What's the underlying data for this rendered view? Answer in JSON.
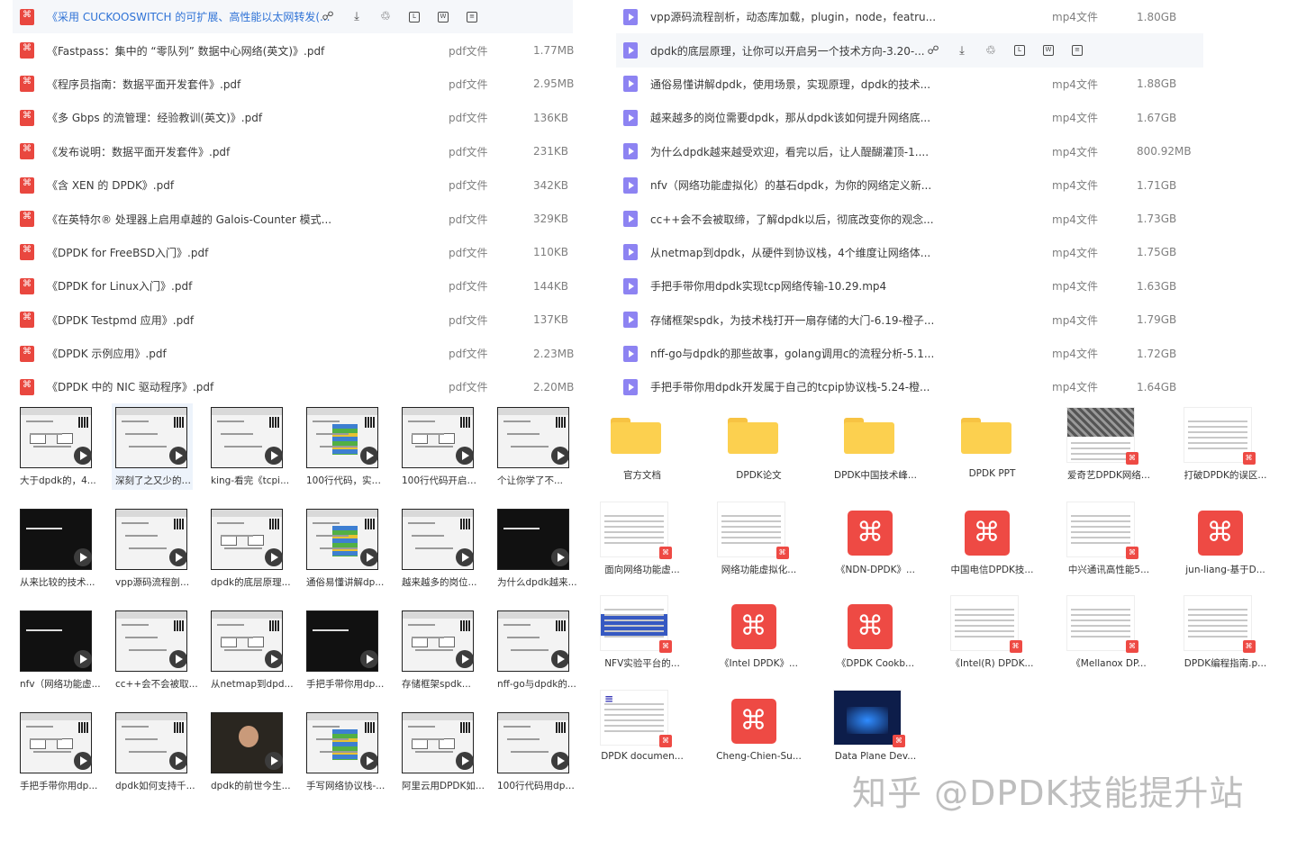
{
  "left_files": [
    {
      "name": "《采用 CUCKOOSWITCH 的可扩展、高性能以太网转发(...",
      "type": "",
      "size": "",
      "highlight": true
    },
    {
      "name": "《Fastpass：集中的 “零队列” 数据中心网络(英文)》.pdf",
      "type": "pdf文件",
      "size": "1.77MB"
    },
    {
      "name": "《程序员指南：数据平面开发套件》.pdf",
      "type": "pdf文件",
      "size": "2.95MB"
    },
    {
      "name": "《多 Gbps 的流管理：经验教训(英文)》.pdf",
      "type": "pdf文件",
      "size": "136KB"
    },
    {
      "name": "《发布说明：数据平面开发套件》.pdf",
      "type": "pdf文件",
      "size": "231KB"
    },
    {
      "name": "《含 XEN 的 DPDK》.pdf",
      "type": "pdf文件",
      "size": "342KB"
    },
    {
      "name": "《在英特尔® 处理器上启用卓越的 Galois-Counter 模式...",
      "type": "pdf文件",
      "size": "329KB"
    },
    {
      "name": "《DPDK for FreeBSD入门》.pdf",
      "type": "pdf文件",
      "size": "110KB"
    },
    {
      "name": "《DPDK for Linux入门》.pdf",
      "type": "pdf文件",
      "size": "144KB"
    },
    {
      "name": "《DPDK Testpmd 应用》.pdf",
      "type": "pdf文件",
      "size": "137KB"
    },
    {
      "name": "《DPDK 示例应用》.pdf",
      "type": "pdf文件",
      "size": "2.23MB"
    },
    {
      "name": "《DPDK 中的 NIC 驱动程序》.pdf",
      "type": "pdf文件",
      "size": "2.20MB"
    }
  ],
  "right_files": [
    {
      "name": "vpp源码流程剖析，动态库加载，plugin，node，featru...",
      "type": "mp4文件",
      "size": "1.80GB"
    },
    {
      "name": "dpdk的底层原理，让你可以开启另一个技术方向-3.20-...",
      "type": "",
      "size": "",
      "highlight": true
    },
    {
      "name": "通俗易懂讲解dpdk，使用场景，实现原理，dpdk的技术...",
      "type": "mp4文件",
      "size": "1.88GB"
    },
    {
      "name": "越来越多的岗位需要dpdk，那从dpdk该如何提升网络底...",
      "type": "mp4文件",
      "size": "1.67GB"
    },
    {
      "name": "为什么dpdk越来越受欢迎，看完以后，让人醍醐灌顶-1....",
      "type": "mp4文件",
      "size": "800.92MB"
    },
    {
      "name": "nfv（网络功能虚拟化）的基石dpdk，为你的网络定义新...",
      "type": "mp4文件",
      "size": "1.71GB"
    },
    {
      "name": "cc++会不会被取缔，了解dpdk以后，彻底改变你的观念...",
      "type": "mp4文件",
      "size": "1.73GB"
    },
    {
      "name": "从netmap到dpdk，从硬件到协议栈，4个维度让网络体...",
      "type": "mp4文件",
      "size": "1.75GB"
    },
    {
      "name": "手把手带你用dpdk实现tcp网络传输-10.29.mp4",
      "type": "mp4文件",
      "size": "1.63GB"
    },
    {
      "name": "存储框架spdk，为技术栈打开一扇存储的大门-6.19-橙子...",
      "type": "mp4文件",
      "size": "1.79GB"
    },
    {
      "name": "nff-go与dpdk的那些故事，golang调用c的流程分析-5.1...",
      "type": "mp4文件",
      "size": "1.72GB"
    },
    {
      "name": "手把手带你用dpdk开发属于自己的tcpip协议栈-5.24-橙...",
      "type": "mp4文件",
      "size": "1.64GB"
    }
  ],
  "thumbs": [
    {
      "caption": "大于dpdk的，4...",
      "style": "diagram"
    },
    {
      "caption": "深刻了之又少的与...",
      "style": "whiteboard",
      "selected": true
    },
    {
      "caption": "king-看完《tcpi...",
      "style": "whiteboard"
    },
    {
      "caption": "100行代码，实现...",
      "style": "chips"
    },
    {
      "caption": "100行代码开启自...",
      "style": "diagram"
    },
    {
      "caption": "个让你学了不...",
      "style": "whiteboard"
    },
    {
      "caption": "从来比较的技术...",
      "style": "terminal"
    },
    {
      "caption": "vpp源码流程剖...",
      "style": "whiteboard"
    },
    {
      "caption": "dpdk的底层原理...",
      "style": "diagram"
    },
    {
      "caption": "通俗易懂讲解dp...",
      "style": "chips"
    },
    {
      "caption": "越来越多的岗位...",
      "style": "whiteboard"
    },
    {
      "caption": "为什么dpdk越来...",
      "style": "terminal"
    },
    {
      "caption": "nfv（网络功能虚...",
      "style": "terminal"
    },
    {
      "caption": "cc++会不会被取...",
      "style": "whiteboard"
    },
    {
      "caption": "从netmap到dpd...",
      "style": "diagram"
    },
    {
      "caption": "手把手带你用dp...",
      "style": "terminal"
    },
    {
      "caption": "存储框架spdk...",
      "style": "diagram"
    },
    {
      "caption": "nff-go与dpdk的...",
      "style": "whiteboard"
    },
    {
      "caption": "手把手带你用dp...",
      "style": "diagram"
    },
    {
      "caption": "dpdk如何支持千...",
      "style": "whiteboard"
    },
    {
      "caption": "dpdk的前世今生...",
      "style": "person"
    },
    {
      "caption": "手写网络协议栈-...",
      "style": "chips"
    },
    {
      "caption": "阿里云用DPDK如...",
      "style": "diagram"
    },
    {
      "caption": "100行代码用dpd...",
      "style": "whiteboard"
    }
  ],
  "grid_items": [
    {
      "caption": "官方文档",
      "kind": "folder"
    },
    {
      "caption": "DPDK论文",
      "kind": "folder"
    },
    {
      "caption": "DPDK中国技术峰...",
      "kind": "folder"
    },
    {
      "caption": "DPDK  PPT",
      "kind": "folder"
    },
    {
      "caption": "爱奇艺DPDK网络...",
      "kind": "photo"
    },
    {
      "caption": "打破DPDK的误区...",
      "kind": "doc"
    },
    {
      "caption": "面向网络功能虚...",
      "kind": "doc"
    },
    {
      "caption": "网络功能虚拟化...",
      "kind": "doc"
    },
    {
      "caption": "《NDN-DPDK》...",
      "kind": "pdf"
    },
    {
      "caption": "中国电信DPDK技...",
      "kind": "pdf"
    },
    {
      "caption": "中兴通讯高性能5...",
      "kind": "doc"
    },
    {
      "caption": "jun-liang-基于D...",
      "kind": "pdf"
    },
    {
      "caption": "NFV实验平台的...",
      "kind": "blue"
    },
    {
      "caption": "《Intel DPDK》...",
      "kind": "pdf"
    },
    {
      "caption": "《DPDK Cookb...",
      "kind": "pdf"
    },
    {
      "caption": "《Intel(R) DPDK...",
      "kind": "doc"
    },
    {
      "caption": "《Mellanox DP...",
      "kind": "doc"
    },
    {
      "caption": "DPDK编程指南.p...",
      "kind": "doc"
    },
    {
      "caption": "DPDK documen...",
      "kind": "dpdklogo"
    },
    {
      "caption": "Cheng-Chien-Su...",
      "kind": "pdf"
    },
    {
      "caption": "Data Plane Dev...",
      "kind": "dark"
    }
  ],
  "icons": {
    "share": "share-icon",
    "download": "download-icon",
    "delete": "trash-icon",
    "rename": "rename-icon",
    "move": "move-icon",
    "more": "more-icon"
  },
  "colors": {
    "pdf_red": "#e9473f",
    "video_purple": "#8d83f2",
    "folder_yellow": "#fcd04f",
    "link_blue": "#2e72d6"
  },
  "watermark": "知乎 @DPDK技能提升站"
}
